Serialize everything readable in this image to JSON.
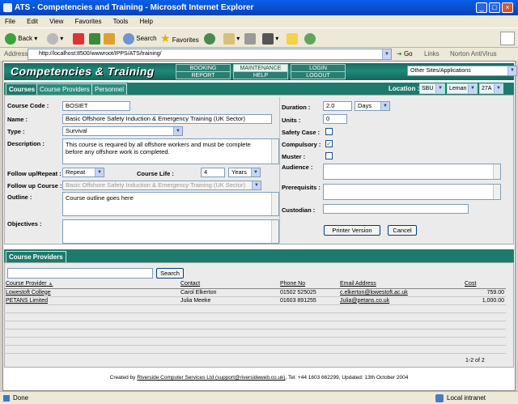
{
  "window": {
    "title": "ATS - Competencies and Training - Microsoft Internet Explorer"
  },
  "menu": [
    "File",
    "Edit",
    "View",
    "Favorites",
    "Tools",
    "Help"
  ],
  "toolbar": {
    "back": "Back",
    "search": "Search",
    "favorites": "Favorites"
  },
  "addressbar": {
    "label": "Address",
    "url": "http://localhost:8500/wwwroot/IPPS/ATS/training/",
    "go": "Go",
    "links": "Links",
    "norton": "Norton AntiVirus"
  },
  "banner": {
    "brand": "Competencies & Training",
    "nav": [
      "BOOKING",
      "MAINTENANCE",
      "LOGIN",
      "REPORT",
      "HELP",
      "LOGOUT"
    ],
    "sites": "Other Sites/Applications"
  },
  "tabs": [
    "Courses",
    "Course Providers",
    "Personnel"
  ],
  "location": {
    "label": "Location :",
    "sbu": "SBU",
    "site": "Leman",
    "area": "27A"
  },
  "form": {
    "course_code_label": "Course Code :",
    "course_code": "BOSIET",
    "name_label": "Name :",
    "name": "Basic Offshore Safety Induction & Emergency Training (UK Sector)",
    "type_label": "Type :",
    "type": "Survival",
    "description_label": "Description :",
    "description": "This course is required by all offshore workers and must be complete before any offshore work is completed.",
    "followup_repeat_label": "Follow up/Repeat :",
    "followup_repeat": "Repeat",
    "course_life_label": "Course Life :",
    "course_life": "4",
    "course_life_unit": "Years",
    "followup_course_label": "Follow up Course :",
    "followup_course": "Basic Offshore Safety Induction & Emergency Training (UK Sector)",
    "outline_label": "Outline :",
    "outline": "Course outline goes here",
    "objectives_label": "Objectives :",
    "objectives": "",
    "duration_label": "Duration :",
    "duration": "2.0",
    "duration_unit": "Days",
    "units_label": "Units :",
    "units": "0",
    "safety_case_label": "Safety Case :",
    "compulsory_label": "Compulsory :",
    "muster_label": "Muster :",
    "audience_label": "Audience :",
    "prerequisites_label": "Prerequisits :",
    "custodian_label": "Custodian :",
    "printer_version": "Printer Version",
    "cancel": "Cancel"
  },
  "providers": {
    "tab": "Course Providers",
    "search_button": "Search",
    "columns": [
      "Course Provider",
      "Contact",
      "Phone No",
      "Email Address",
      "Cost"
    ],
    "rows": [
      [
        "Lowestoft College",
        "Carol Elkerton",
        "01502 525025",
        "c.elkerton@lowestoft.ac.uk",
        "759.00"
      ],
      [
        "PETANS Limited",
        "Julia Meeke",
        "01603 891255",
        "Julia@petans.co.uk",
        "1,000.00"
      ]
    ],
    "pager": "1-2 of 2"
  },
  "footer": {
    "text_prefix": "Created by",
    "company": "Riverside Computer Services Ltd (support@riversideweb.co.uk)",
    "text_suffix": ", Tel: +44 1603 662299, Updated: 13th October 2004"
  },
  "statusbar": {
    "status": "Done",
    "zone": "Local intranet"
  }
}
